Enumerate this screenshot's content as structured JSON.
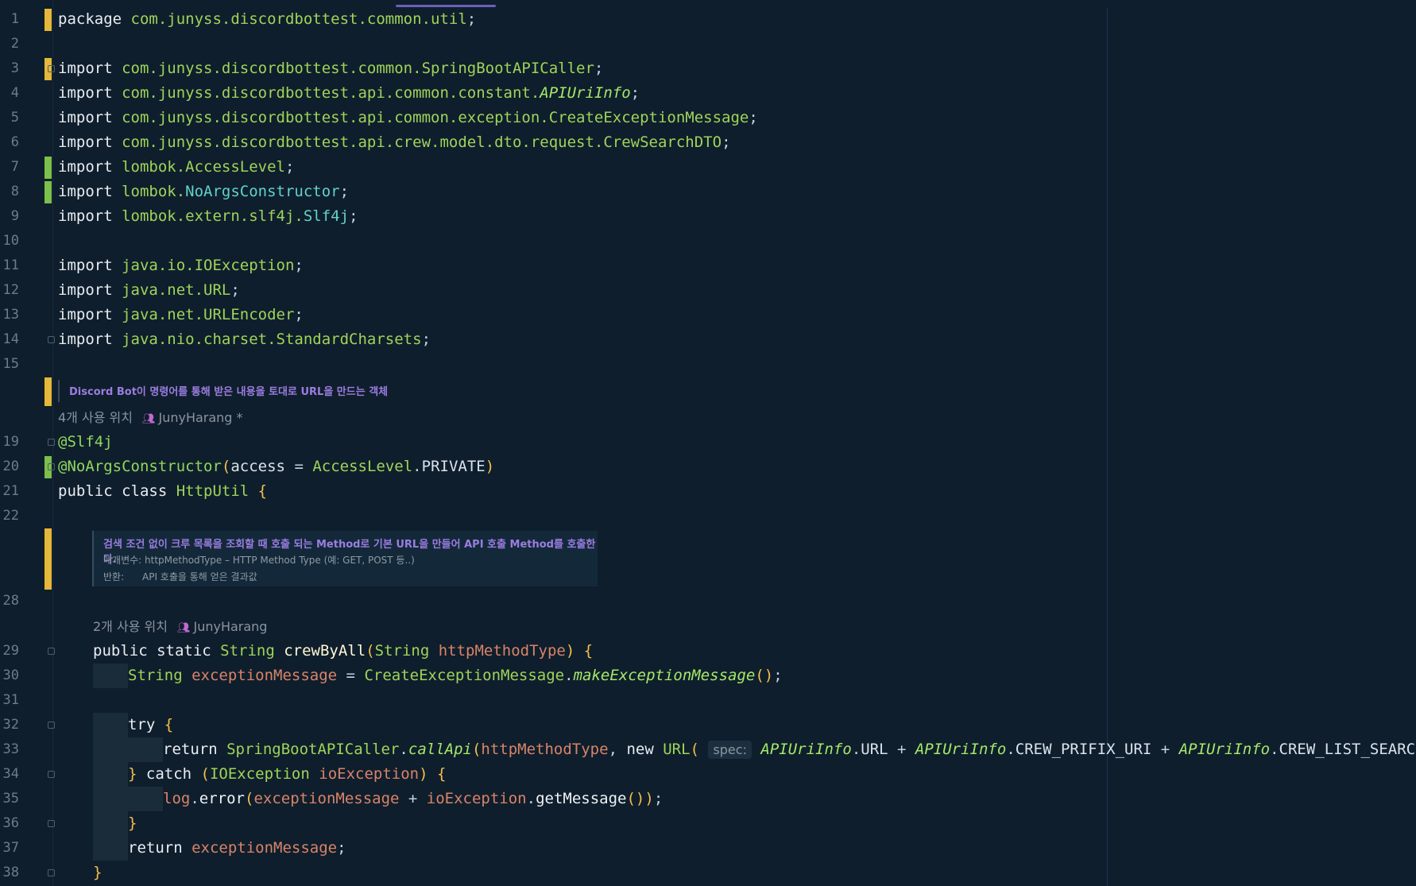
{
  "editor": {
    "colors": {
      "background": "#0f1e2c",
      "modified_marker": "#e5b83a",
      "added_marker": "#7cbf4a"
    },
    "lines": [
      {
        "num": "1",
        "marker": "modified",
        "tokens": [
          [
            "kw",
            "package "
          ],
          [
            "pkg",
            "com.junyss.discordbottest.common.util"
          ],
          [
            "punc",
            ";"
          ]
        ]
      },
      {
        "num": "2",
        "tokens": []
      },
      {
        "num": "3",
        "marker": "modified",
        "fold": true,
        "tokens": [
          [
            "kw",
            "import "
          ],
          [
            "pkg",
            "com.junyss.discordbottest.common.SpringBootAPICaller"
          ],
          [
            "punc",
            ";"
          ]
        ]
      },
      {
        "num": "4",
        "tokens": [
          [
            "kw",
            "import "
          ],
          [
            "pkg",
            "com.junyss.discordbottest.api.common.constant."
          ],
          [
            "ital",
            "APIUriInfo"
          ],
          [
            "punc",
            ";"
          ]
        ]
      },
      {
        "num": "5",
        "tokens": [
          [
            "kw",
            "import "
          ],
          [
            "pkg",
            "com.junyss.discordbottest.api.common.exception.CreateExceptionMessage"
          ],
          [
            "punc",
            ";"
          ]
        ]
      },
      {
        "num": "6",
        "tokens": [
          [
            "kw",
            "import "
          ],
          [
            "pkg",
            "com.junyss.discordbottest.api.crew.model.dto.request.CrewSearchDTO"
          ],
          [
            "punc",
            ";"
          ]
        ]
      },
      {
        "num": "7",
        "marker": "added",
        "tokens": [
          [
            "kw",
            "import "
          ],
          [
            "pkg",
            "lombok.AccessLevel"
          ],
          [
            "punc",
            ";"
          ]
        ]
      },
      {
        "num": "8",
        "marker": "added",
        "tokens": [
          [
            "kw",
            "import "
          ],
          [
            "pkg",
            "lombok."
          ],
          [
            "typ",
            "NoArgsConstructor"
          ],
          [
            "punc",
            ";"
          ]
        ]
      },
      {
        "num": "9",
        "tokens": [
          [
            "kw",
            "import "
          ],
          [
            "pkg",
            "lombok.extern.slf4j."
          ],
          [
            "typ",
            "Slf4j"
          ],
          [
            "punc",
            ";"
          ]
        ]
      },
      {
        "num": "10",
        "tokens": []
      },
      {
        "num": "11",
        "tokens": [
          [
            "kw",
            "import "
          ],
          [
            "pkg",
            "java.io.IOException"
          ],
          [
            "punc",
            ";"
          ]
        ]
      },
      {
        "num": "12",
        "tokens": [
          [
            "kw",
            "import "
          ],
          [
            "pkg",
            "java.net.URL"
          ],
          [
            "punc",
            ";"
          ]
        ]
      },
      {
        "num": "13",
        "tokens": [
          [
            "kw",
            "import "
          ],
          [
            "pkg",
            "java.net.URLEncoder"
          ],
          [
            "punc",
            ";"
          ]
        ]
      },
      {
        "num": "14",
        "fold": true,
        "tokens": [
          [
            "kw",
            "import "
          ],
          [
            "pkg",
            "java.nio.charset.StandardCharsets"
          ],
          [
            "punc",
            ";"
          ]
        ]
      },
      {
        "num": "15",
        "tokens": []
      },
      {
        "num": "19",
        "fold": true,
        "tokens": [
          [
            "ann",
            "@Slf4j"
          ]
        ]
      },
      {
        "num": "20",
        "marker": "added",
        "fold": true,
        "tokens": [
          [
            "ann",
            "@NoArgsConstructor"
          ],
          [
            "br",
            "("
          ],
          [
            "const",
            "access "
          ],
          [
            "op",
            "= "
          ],
          [
            "cls",
            "AccessLevel"
          ],
          [
            "punc",
            "."
          ],
          [
            "const",
            "PRIVATE"
          ],
          [
            "br",
            ")"
          ]
        ]
      },
      {
        "num": "21",
        "tokens": [
          [
            "kw",
            "public class "
          ],
          [
            "cls",
            "HttpUtil "
          ],
          [
            "br",
            "{"
          ]
        ]
      },
      {
        "num": "22",
        "tokens": []
      },
      {
        "num": "28",
        "tokens": []
      },
      {
        "num": "29",
        "fold": true,
        "indent": 1,
        "tokens": [
          [
            "kw",
            "public static "
          ],
          [
            "cls",
            "String "
          ],
          [
            "fn",
            "crewByAll"
          ],
          [
            "br",
            "("
          ],
          [
            "cls",
            "String "
          ],
          [
            "par",
            "httpMethodType"
          ],
          [
            "br",
            ") {"
          ]
        ]
      },
      {
        "num": "30",
        "indent": 2,
        "guides": 1,
        "tokens": [
          [
            "cls",
            "String "
          ],
          [
            "var",
            "exceptionMessage "
          ],
          [
            "op",
            "= "
          ],
          [
            "cls",
            "CreateExceptionMessage"
          ],
          [
            "punc",
            "."
          ],
          [
            "ital",
            "makeExceptionMessage"
          ],
          [
            "br",
            "()"
          ],
          [
            "punc",
            ";"
          ]
        ]
      },
      {
        "num": "31",
        "indent": 0,
        "tokens": []
      },
      {
        "num": "32",
        "fold": true,
        "indent": 2,
        "guides": 1,
        "tokens": [
          [
            "kw",
            "try "
          ],
          [
            "br",
            "{"
          ]
        ]
      },
      {
        "num": "33",
        "indent": 3,
        "guides": 2,
        "tokens": [
          [
            "kw",
            "return "
          ],
          [
            "cls",
            "SpringBootAPICaller"
          ],
          [
            "punc",
            "."
          ],
          [
            "ital",
            "callApi"
          ],
          [
            "br",
            "("
          ],
          [
            "par",
            "httpMethodType"
          ],
          [
            "punc",
            ", "
          ],
          [
            "kw",
            "new "
          ],
          [
            "cls",
            "URL"
          ],
          [
            "br",
            "( "
          ],
          [
            "hint",
            "spec:"
          ],
          [
            "punc",
            " "
          ],
          [
            "ital",
            "APIUriInfo"
          ],
          [
            "punc",
            "."
          ],
          [
            "const",
            "URL "
          ],
          [
            "op",
            "+ "
          ],
          [
            "ital",
            "APIUriInfo"
          ],
          [
            "punc",
            "."
          ],
          [
            "const",
            "CREW_PRIFIX_URI "
          ],
          [
            "op",
            "+ "
          ],
          [
            "ital",
            "APIUriInfo"
          ],
          [
            "punc",
            "."
          ],
          [
            "const",
            "CREW_LIST_SEARCH"
          ],
          [
            "br",
            "))"
          ],
          [
            "punc",
            ";"
          ]
        ]
      },
      {
        "num": "34",
        "fold": true,
        "indent": 2,
        "guides": 1,
        "tokens": [
          [
            "br",
            "} "
          ],
          [
            "kw",
            "catch "
          ],
          [
            "br",
            "("
          ],
          [
            "cls",
            "IOException "
          ],
          [
            "par",
            "ioException"
          ],
          [
            "br",
            ") {"
          ]
        ]
      },
      {
        "num": "35",
        "indent": 3,
        "guides": 2,
        "tokens": [
          [
            "var",
            "log"
          ],
          [
            "punc",
            "."
          ],
          [
            "mcall",
            "error"
          ],
          [
            "br",
            "("
          ],
          [
            "var",
            "exceptionMessage "
          ],
          [
            "op",
            "+ "
          ],
          [
            "par",
            "ioException"
          ],
          [
            "punc",
            "."
          ],
          [
            "mcall",
            "getMessage"
          ],
          [
            "br",
            "())"
          ],
          [
            "punc",
            ";"
          ]
        ]
      },
      {
        "num": "36",
        "fold": true,
        "indent": 2,
        "guides": 1,
        "tokens": [
          [
            "br",
            "}"
          ]
        ]
      },
      {
        "num": "37",
        "indent": 2,
        "guides": 1,
        "tokens": [
          [
            "kw",
            "return "
          ],
          [
            "var",
            "exceptionMessage"
          ],
          [
            "punc",
            ";"
          ]
        ]
      },
      {
        "num": "38",
        "fold": true,
        "indent": 1,
        "tokens": [
          [
            "br",
            "}"
          ]
        ]
      }
    ],
    "class_doc": "Discord Bot이 명령어를 통해 받은 내용을 토대로 URL을 만드는 객체",
    "class_usage": "4개 사용 위치",
    "class_author": "JunyHarang *",
    "method_doc": {
      "main": "검색 조건 없이 크루 목록을 조회할 때 호출 되는 Method로 기본 URL을 만들어 API 호출 Method를 호출한다.",
      "param": "매개변수: httpMethodType – HTTP Method Type (예: GET, POST 등..)",
      "returns": "반환:      API 호출을 통해 얻은 결과값"
    },
    "method_usage": "2개 사용 위치",
    "method_author": "JunyHarang"
  }
}
